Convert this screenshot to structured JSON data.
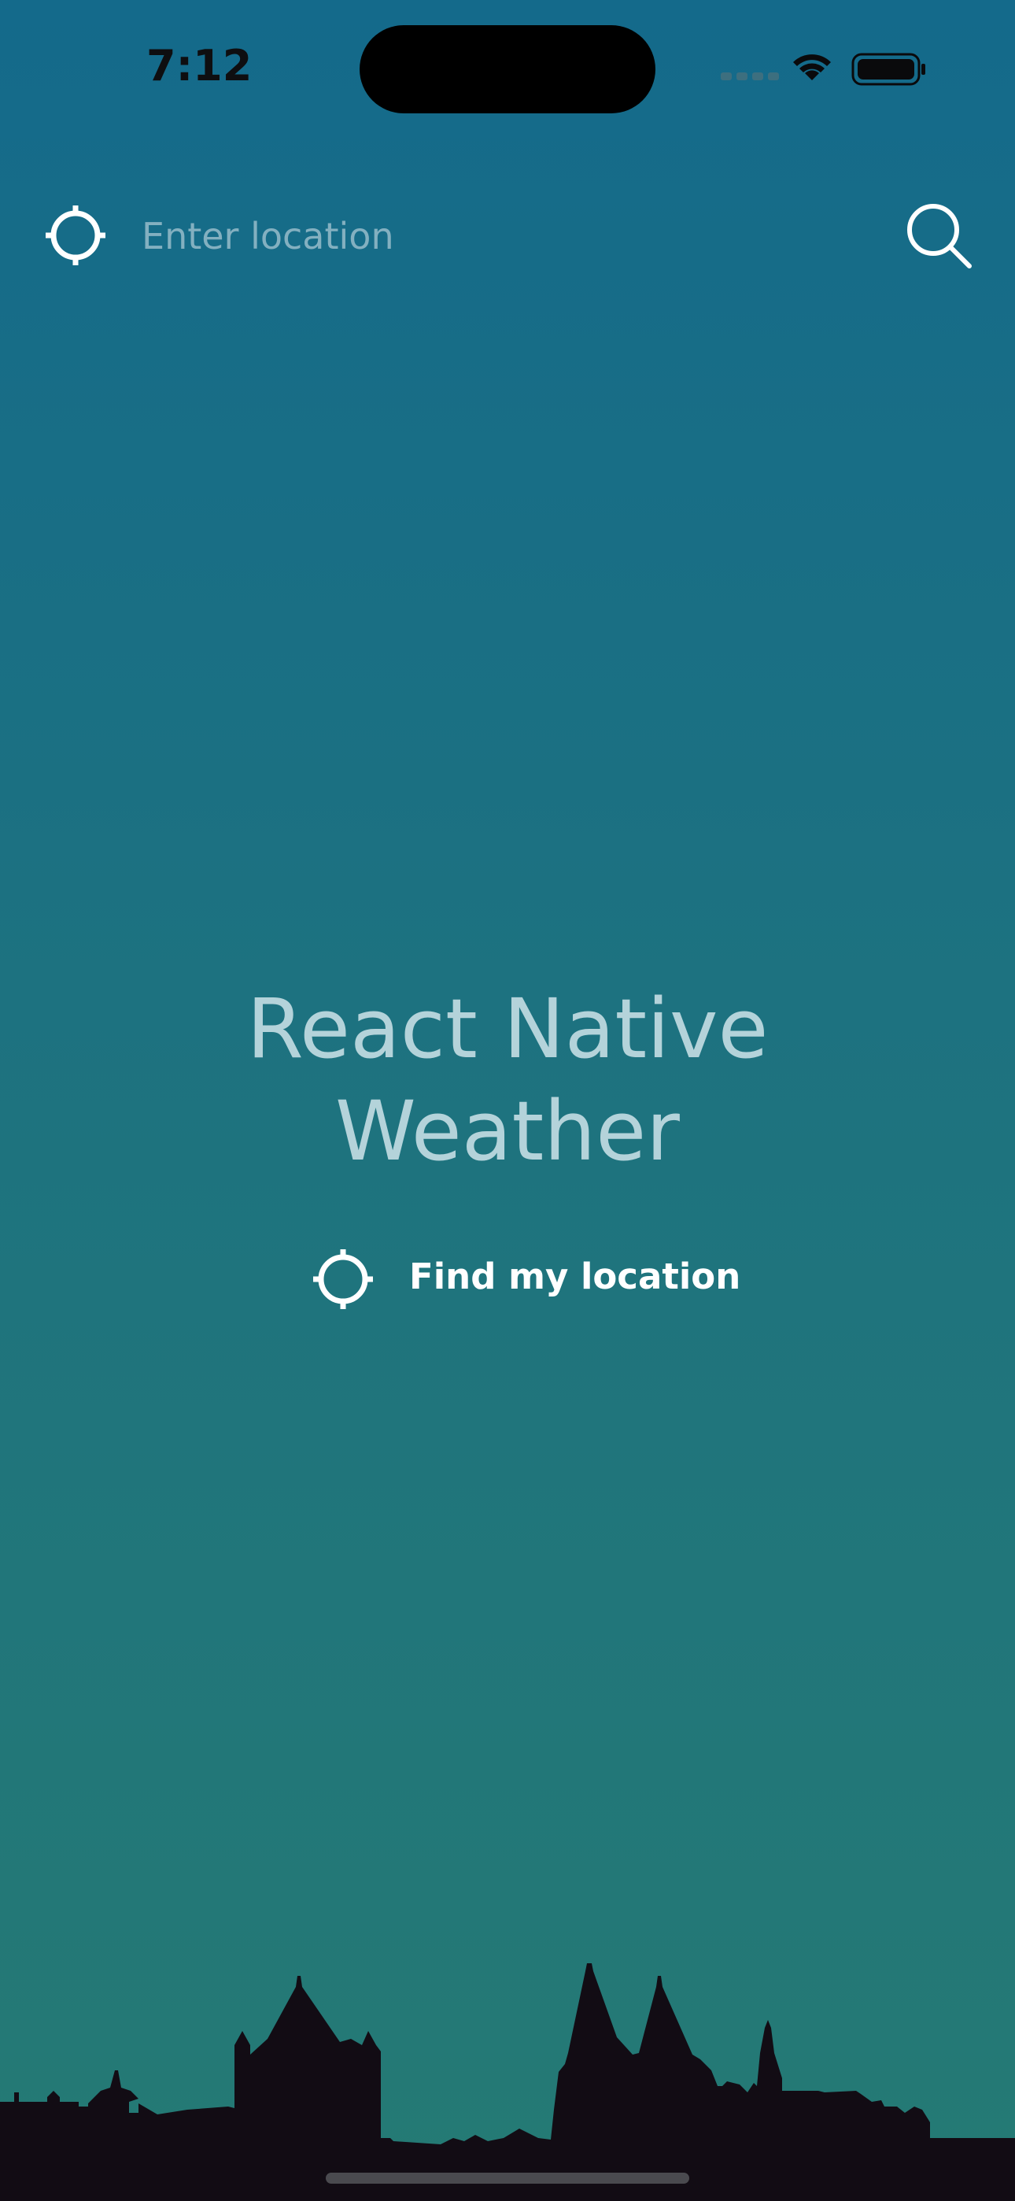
{
  "status_bar": {
    "time": "7:12"
  },
  "search": {
    "placeholder": "Enter location",
    "value": "",
    "locate_icon": "crosshair-icon",
    "search_icon": "magnifier-icon"
  },
  "main": {
    "title_line1": "React Native",
    "title_line2": "Weather",
    "find_location_label": "Find my location",
    "find_location_icon": "crosshair-icon"
  },
  "colors": {
    "background_top": "#146a8b",
    "background_bottom": "#257a74",
    "title": "#b4d3da",
    "skyline": "#120c14"
  }
}
